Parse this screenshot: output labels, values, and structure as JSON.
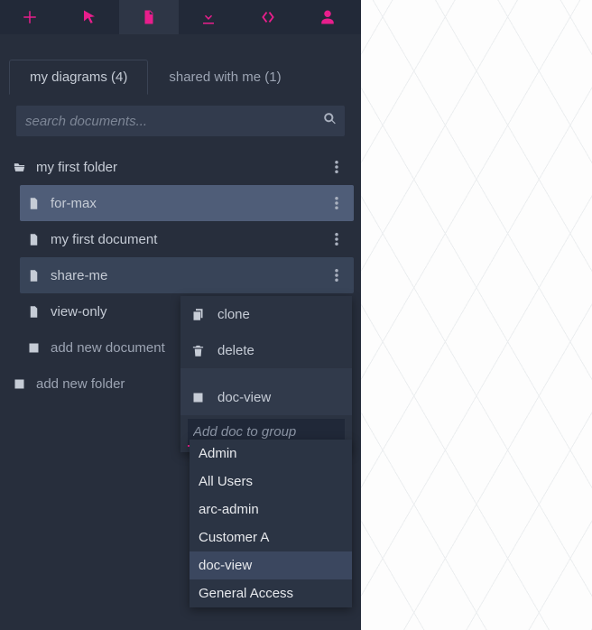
{
  "toolbar": {
    "icons": [
      "plus-icon",
      "cursor-icon",
      "file-icon",
      "download-icon",
      "code-icon",
      "user-icon"
    ],
    "active_index": 2
  },
  "tabs": {
    "my_label": "my diagrams (4)",
    "shared_label": "shared with me (1)"
  },
  "search": {
    "placeholder": "search documents..."
  },
  "folder": {
    "name": "my first folder",
    "add_folder_label": "add new folder",
    "add_doc_label": "add new document",
    "items": [
      {
        "label": "for-max"
      },
      {
        "label": "my first document"
      },
      {
        "label": "share-me"
      },
      {
        "label": "view-only"
      }
    ]
  },
  "ctx": {
    "clone": "clone",
    "delete": "delete",
    "group_label": "doc-view",
    "add_group_placeholder": "Add doc to group"
  },
  "groups": {
    "items": [
      "Admin",
      "All Users",
      "arc-admin",
      "Customer A",
      "doc-view",
      "General Access"
    ],
    "highlight_index": 4
  }
}
